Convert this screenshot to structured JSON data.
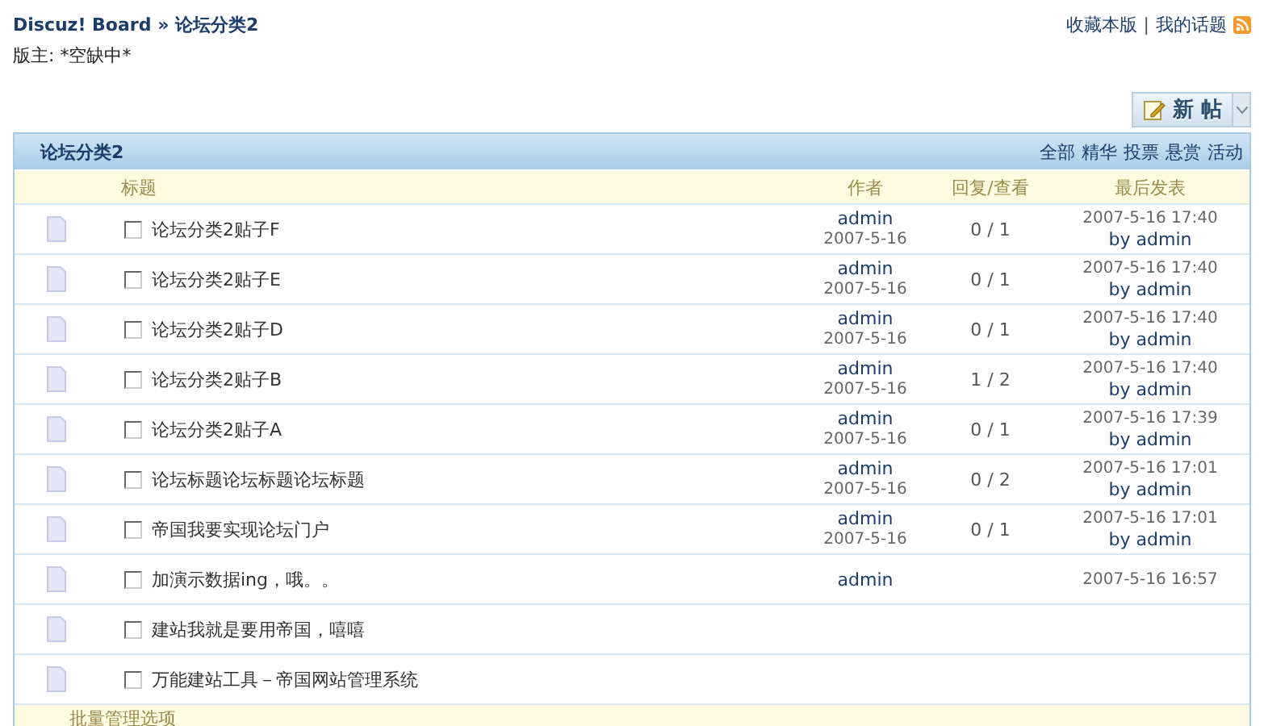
{
  "breadcrumb": {
    "site": "Discuz! Board",
    "separator": "»",
    "current": "论坛分类2"
  },
  "top_links": [
    "收藏本版",
    "我的话题"
  ],
  "link_separator": "|",
  "moderator": "版主: *空缺中*",
  "new_post_button": {
    "label": "新 帖"
  },
  "forum": {
    "title": "论坛分类2",
    "filters": [
      "全部",
      "精华",
      "投票",
      "悬赏",
      "活动"
    ]
  },
  "columns": {
    "title": "标题",
    "author": "作者",
    "replies": "回复/查看",
    "last_post": "最后发表"
  },
  "threads": [
    {
      "title": "论坛分类2贴子F",
      "checked": false,
      "author": "admin",
      "date": "2007-5-16",
      "replies": "0 / 1",
      "last_time": "2007-5-16 17:40",
      "last_by": "by admin"
    },
    {
      "title": "论坛分类2贴子E",
      "checked": false,
      "author": "admin",
      "date": "2007-5-16",
      "replies": "0 / 1",
      "last_time": "2007-5-16 17:40",
      "last_by": "by admin"
    },
    {
      "title": "论坛分类2贴子D",
      "checked": false,
      "author": "admin",
      "date": "2007-5-16",
      "replies": "0 / 1",
      "last_time": "2007-5-16 17:40",
      "last_by": "by admin"
    },
    {
      "title": "论坛分类2贴子B",
      "checked": false,
      "author": "admin",
      "date": "2007-5-16",
      "replies": "1 / 2",
      "last_time": "2007-5-16 17:40",
      "last_by": "by admin"
    },
    {
      "title": "论坛分类2贴子A",
      "checked": false,
      "author": "admin",
      "date": "2007-5-16",
      "replies": "0 / 1",
      "last_time": "2007-5-16 17:39",
      "last_by": "by admin"
    },
    {
      "title": "论坛标题论坛标题论坛标题",
      "checked": false,
      "author": "admin",
      "date": "2007-5-16",
      "replies": "0 / 2",
      "last_time": "2007-5-16 17:01",
      "last_by": "by admin"
    },
    {
      "title": "帝国我要实现论坛门户",
      "checked": false,
      "author": "admin",
      "date": "2007-5-16",
      "replies": "0 / 1",
      "last_time": "2007-5-16 17:01",
      "last_by": "by admin"
    },
    {
      "title": "加演示数据ing，哦。。",
      "checked": false,
      "author": "admin",
      "last_time": "2007-5-16 16:57"
    },
    {
      "title": "建站我就是要用帝国，嘻嘻",
      "checked": false
    },
    {
      "title": "万能建站工具－帝国网站管理系统",
      "checked": false
    }
  ],
  "footer": "批量管理选项"
}
